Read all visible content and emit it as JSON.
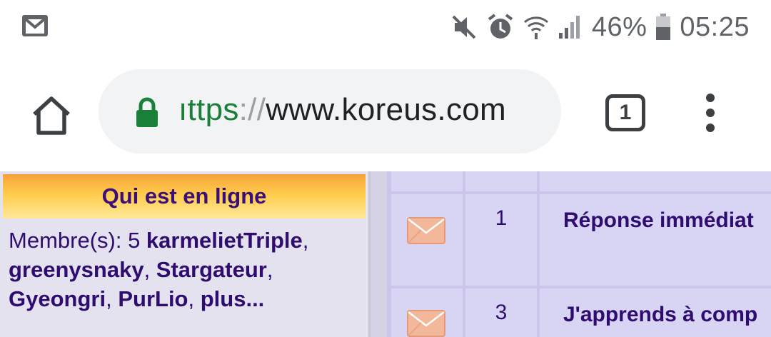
{
  "status_bar": {
    "icons": {
      "left": "gmail-icon",
      "right": [
        "mute-icon",
        "alarm-icon",
        "wifi-icon",
        "signal-icon",
        "battery-icon"
      ]
    },
    "battery_percent": "46%",
    "time": "05:25"
  },
  "toolbar": {
    "url": {
      "scheme": "ıttps",
      "separator": "://",
      "host": "www.koreus.com"
    },
    "tab_count": "1"
  },
  "sidebar": {
    "title": "Qui est en ligne",
    "members_label": "Membre(s): 5 ",
    "members": [
      "karmelietTriple",
      "greenysnaky",
      "Stargateur",
      "Gyeongri",
      "PurLio"
    ],
    "more": "plus..."
  },
  "topics": [
    {
      "icon": "envelope-icon",
      "count": "1",
      "title": "Réponse immédiat"
    },
    {
      "icon": "envelope-icon",
      "count": "3",
      "title": "J'apprends à comp"
    }
  ],
  "colors": {
    "header_gradient_top": "#f7a238",
    "header_gradient_bottom": "#ffe898",
    "text_purple": "#2f0d70",
    "table_cell": "#d8d4f4",
    "url_scheme": "#188038"
  }
}
